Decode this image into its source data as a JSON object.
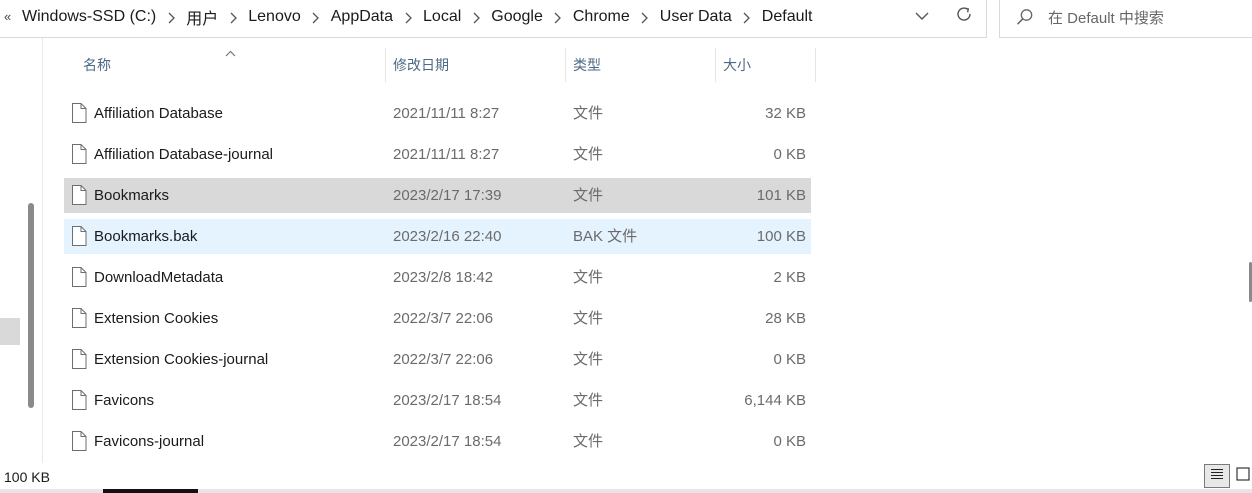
{
  "address_bar": {
    "overflow": "«",
    "crumbs": [
      "Windows-SSD (C:)",
      "用户",
      "Lenovo",
      "AppData",
      "Local",
      "Google",
      "Chrome",
      "User Data",
      "Default"
    ]
  },
  "search": {
    "placeholder": "在 Default 中搜索"
  },
  "columns": {
    "name": "名称",
    "date": "修改日期",
    "type": "类型",
    "size": "大小"
  },
  "files": [
    {
      "name": "Affiliation Database",
      "date": "2021/11/11 8:27",
      "type": "文件",
      "size": "32 KB",
      "state": ""
    },
    {
      "name": "Affiliation Database-journal",
      "date": "2021/11/11 8:27",
      "type": "文件",
      "size": "0 KB",
      "state": ""
    },
    {
      "name": "Bookmarks",
      "date": "2023/2/17 17:39",
      "type": "文件",
      "size": "101 KB",
      "state": "selected"
    },
    {
      "name": "Bookmarks.bak",
      "date": "2023/2/16 22:40",
      "type": "BAK 文件",
      "size": "100 KB",
      "state": "hover"
    },
    {
      "name": "DownloadMetadata",
      "date": "2023/2/8 18:42",
      "type": "文件",
      "size": "2 KB",
      "state": ""
    },
    {
      "name": "Extension Cookies",
      "date": "2022/3/7 22:06",
      "type": "文件",
      "size": "28 KB",
      "state": ""
    },
    {
      "name": "Extension Cookies-journal",
      "date": "2022/3/7 22:06",
      "type": "文件",
      "size": "0 KB",
      "state": ""
    },
    {
      "name": "Favicons",
      "date": "2023/2/17 18:54",
      "type": "文件",
      "size": "6,144 KB",
      "state": ""
    },
    {
      "name": "Favicons-journal",
      "date": "2023/2/17 18:54",
      "type": "文件",
      "size": "0 KB",
      "state": ""
    }
  ],
  "status": {
    "selection_size": "100 KB"
  },
  "colors": {
    "selected_row": "#d9d9d9",
    "hover_row": "#e5f3ff",
    "header_text": "#4d6a86"
  }
}
